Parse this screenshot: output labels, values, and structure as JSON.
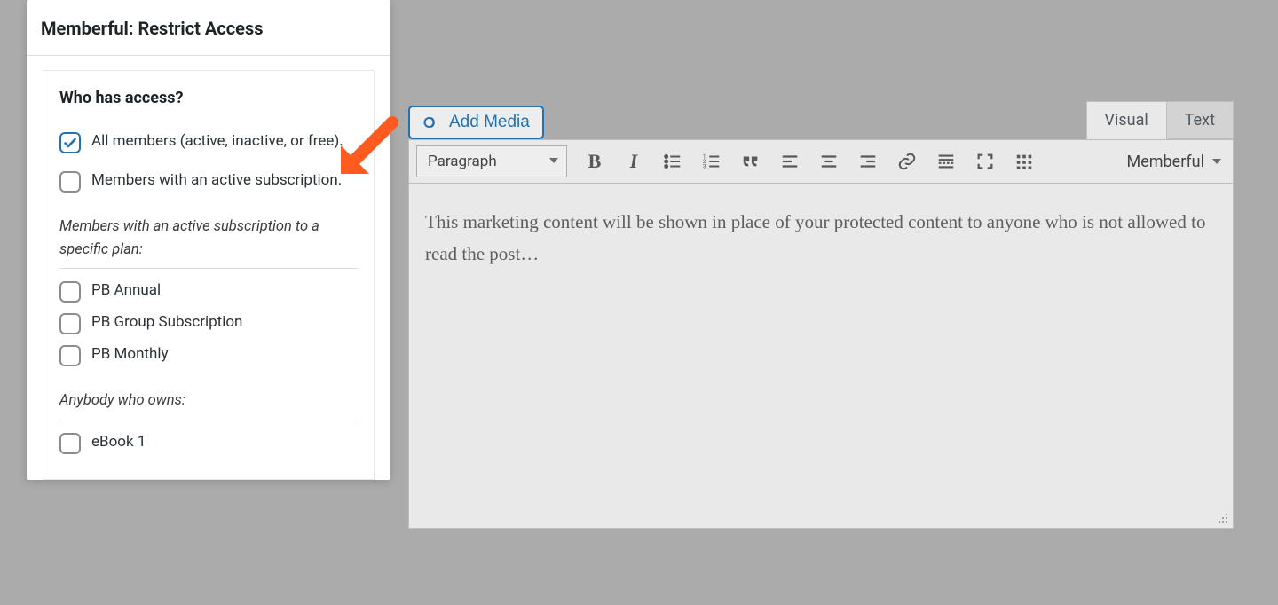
{
  "panel": {
    "title": "Memberful: Restrict Access",
    "who_label": "Who has access?",
    "options": [
      {
        "label": "All members (active, inactive, or free).",
        "checked": true
      },
      {
        "label": "Members with an active subscription.",
        "checked": false
      }
    ],
    "plans_label": "Members with an active subscription to a specific plan:",
    "plans": [
      {
        "label": "PB Annual",
        "checked": false
      },
      {
        "label": "PB Group Subscription",
        "checked": false
      },
      {
        "label": "PB Monthly",
        "checked": false
      }
    ],
    "owns_label": "Anybody who owns:",
    "owns": [
      {
        "label": "eBook 1",
        "checked": false
      }
    ]
  },
  "editor": {
    "add_media": "Add Media",
    "tabs": {
      "visual": "Visual",
      "text": "Text",
      "active": "visual"
    },
    "paragraph_label": "Paragraph",
    "memberful_dropdown": "Memberful",
    "body_text": "This marketing content will be shown in place of your protected content to anyone who is not allowed to read the post…"
  },
  "colors": {
    "accent": "#2271b1",
    "annotation": "#ff5a1f"
  }
}
